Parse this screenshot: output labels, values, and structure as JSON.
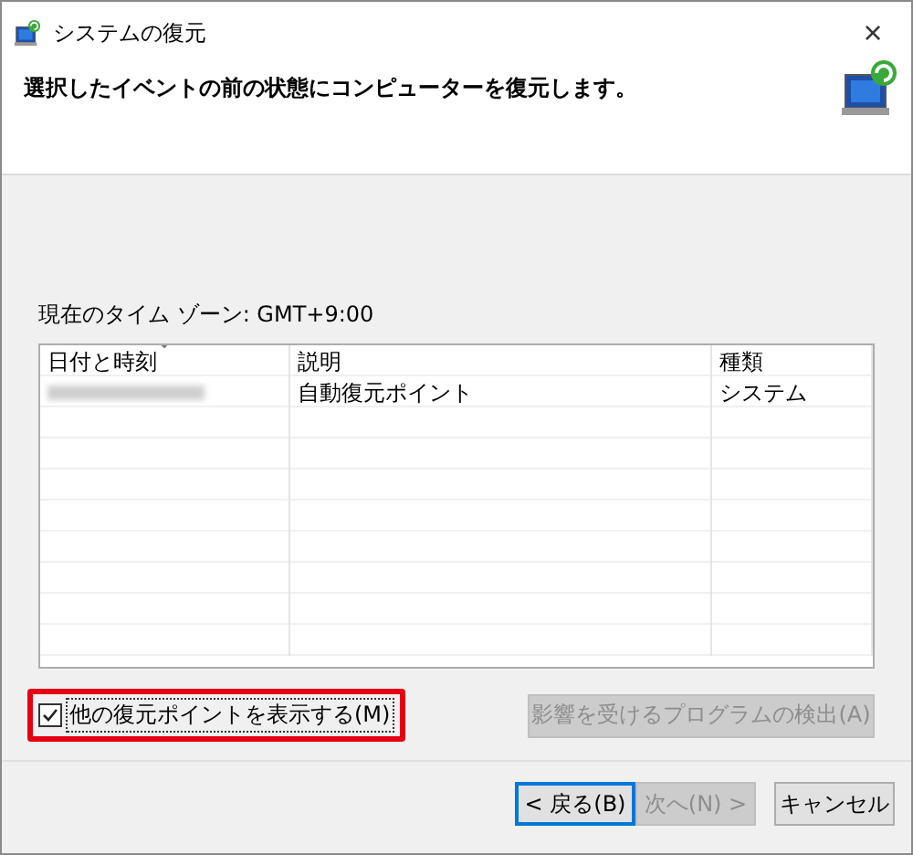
{
  "window": {
    "title": "システムの復元",
    "close": "×"
  },
  "header": {
    "instruction": "選択したイベントの前の状態にコンピューターを復元します。"
  },
  "timezone": "現在のタイム ゾーン: GMT+9:00",
  "table": {
    "columns": [
      {
        "label": "日付と時刻",
        "sorted": true
      },
      {
        "label": "説明",
        "sorted": false
      },
      {
        "label": "種類",
        "sorted": false
      }
    ],
    "rows": [
      {
        "date_redacted": true,
        "description": "自動復元ポイント",
        "type": "システム",
        "selected": false
      }
    ]
  },
  "show_more": {
    "label": "他の復元ポイントを表示する(M)",
    "checked": true,
    "highlighted": true
  },
  "scan_button": {
    "label": "影響を受けるプログラムの検出(A)",
    "disabled": true
  },
  "buttons": [
    {
      "label": "< 戻る(B)",
      "disabled": false,
      "focused": true
    },
    {
      "label": "次へ(N) >",
      "disabled": true,
      "focused": false
    },
    {
      "label": "キャンセル",
      "disabled": false,
      "focused": false
    }
  ]
}
